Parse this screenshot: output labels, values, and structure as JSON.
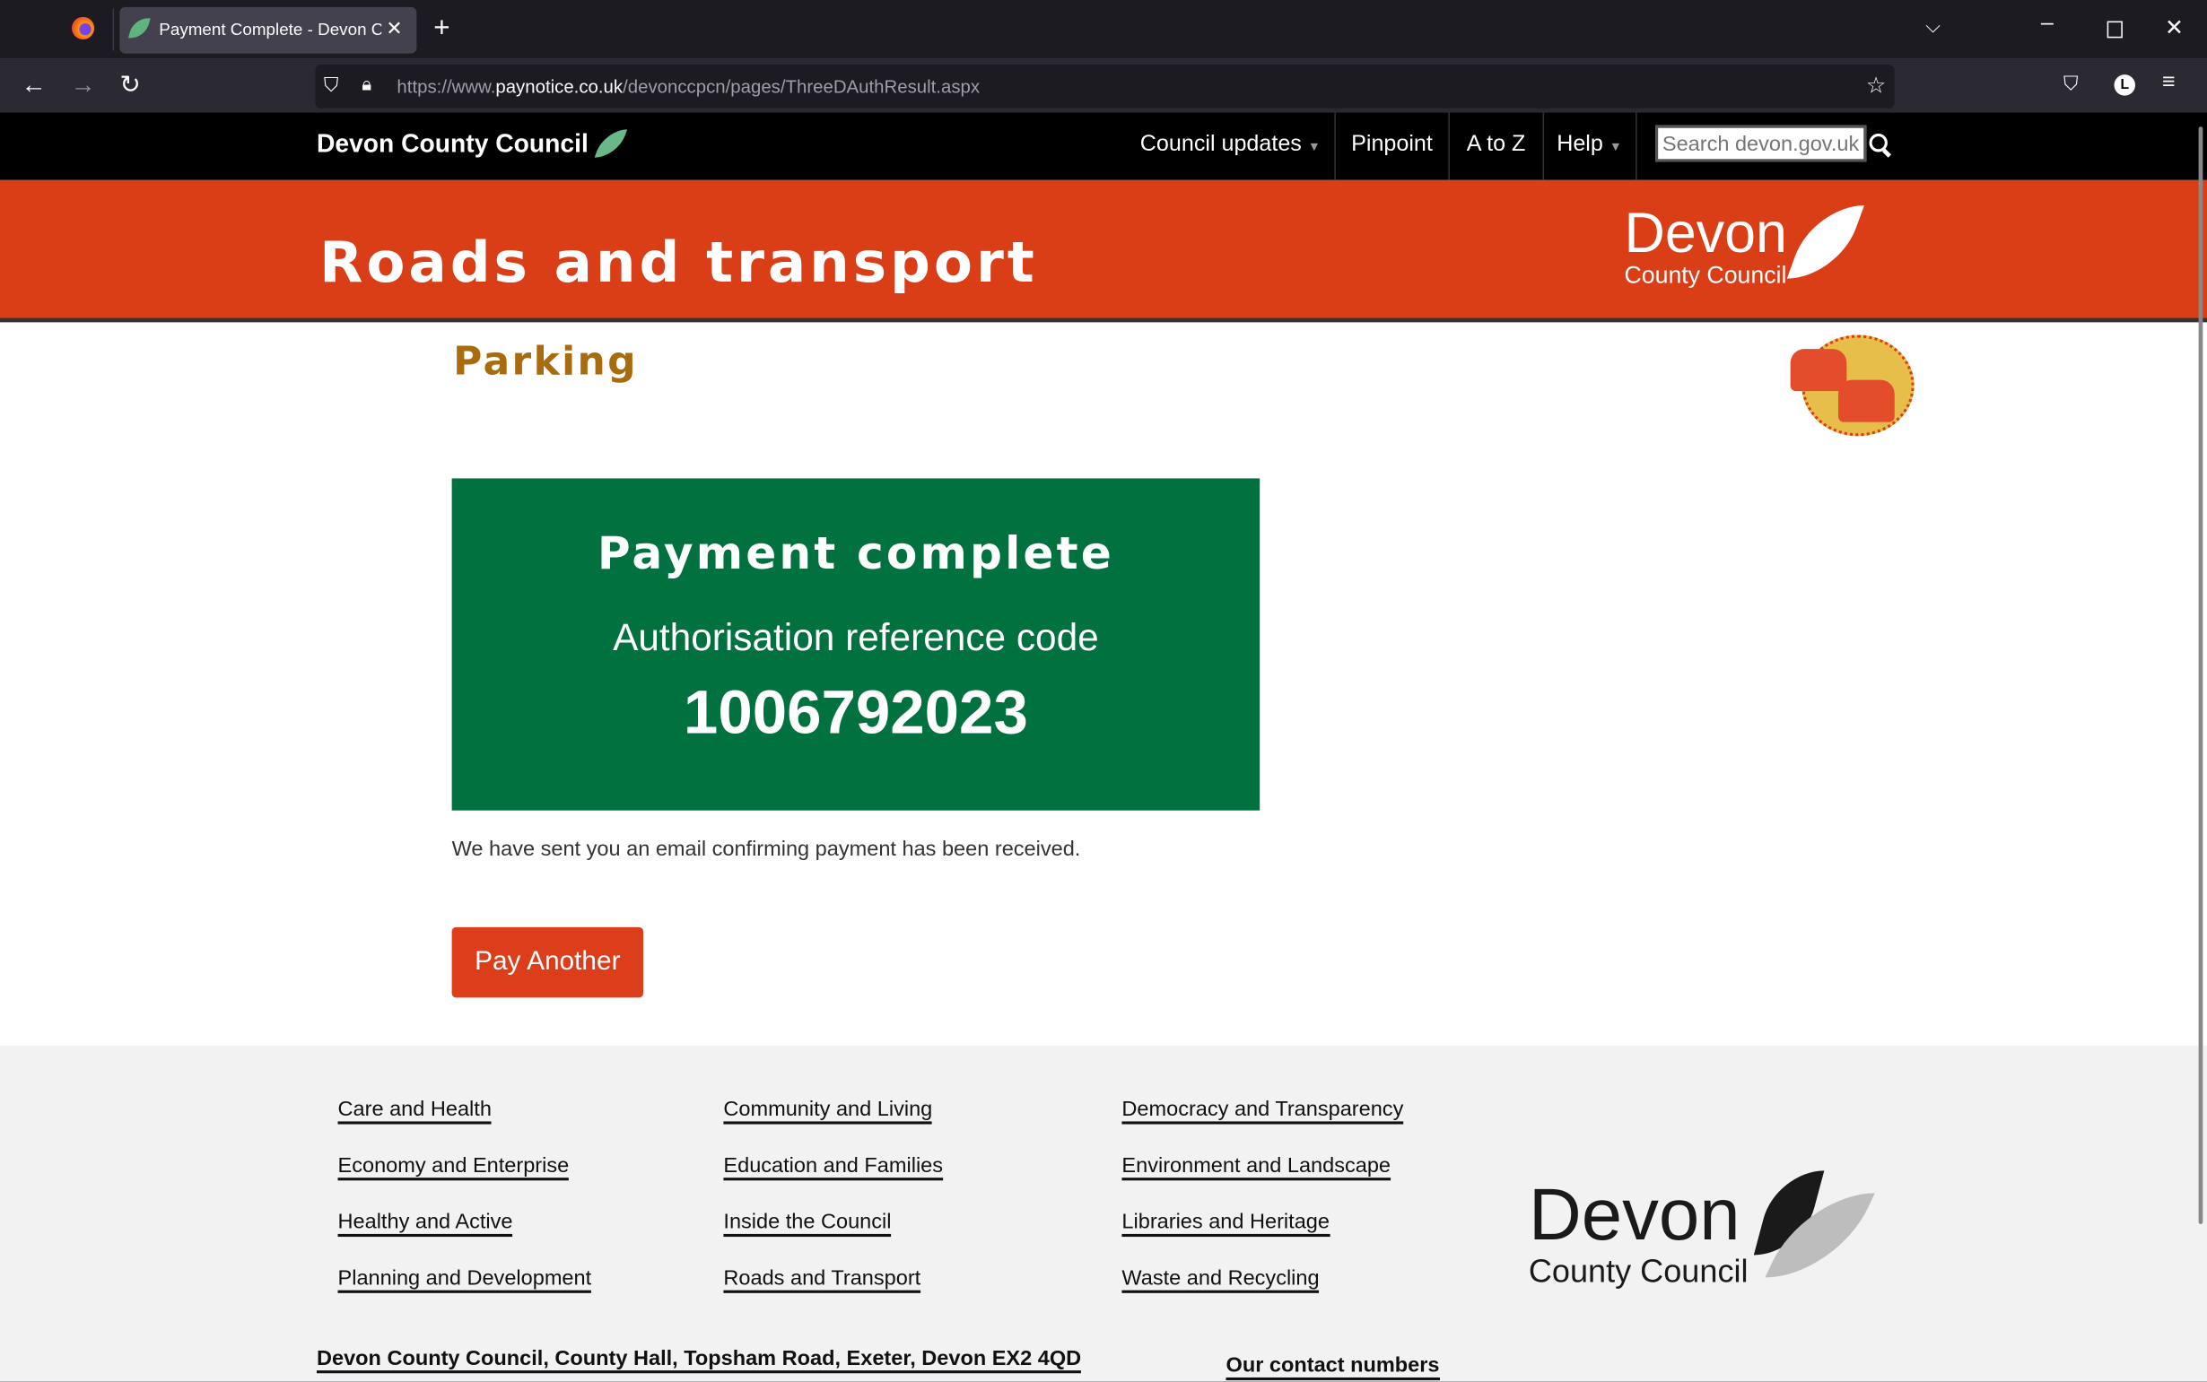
{
  "browser": {
    "tab_title": "Payment Complete - Devon County Council",
    "url_prefix": "https://www.",
    "url_domain": "paynotice.co.uk",
    "url_path": "/devonccpcn/pages/ThreeDAuthResult.aspx",
    "profile_initial": "L"
  },
  "nav": {
    "logo_text": "Devon County Council",
    "items": [
      "Council updates",
      "Pinpoint",
      "A to Z",
      "Help"
    ],
    "search_placeholder": "Search devon.gov.uk"
  },
  "banner": {
    "title": "Roads and transport",
    "logo_line1": "Devon",
    "logo_line2": "County Council"
  },
  "page": {
    "section": "Parking",
    "heading": "Payment complete",
    "auth_label": "Authorisation reference code",
    "auth_code": "1006792023",
    "message": "We have sent you an email confirming payment has been received.",
    "button": "Pay Another"
  },
  "colors": {
    "banner": "#d93e17",
    "success": "#00713f",
    "section": "#a86c0e",
    "button": "#dc3d1a"
  },
  "footer": {
    "columns": [
      [
        "Care and Health",
        "Economy and Enterprise",
        "Healthy and Active",
        "Planning and Development"
      ],
      [
        "Community and Living",
        "Education and Families",
        "Inside the Council",
        "Roads and Transport"
      ],
      [
        "Democracy and Transparency",
        "Environment and Landscape",
        "Libraries and Heritage",
        "Waste and Recycling"
      ]
    ],
    "address": "Devon County Council, County Hall, Topsham Road, Exeter, Devon EX2 4QD",
    "contact": "Our contact numbers",
    "logo_line1": "Devon",
    "logo_line2": "County Council"
  }
}
